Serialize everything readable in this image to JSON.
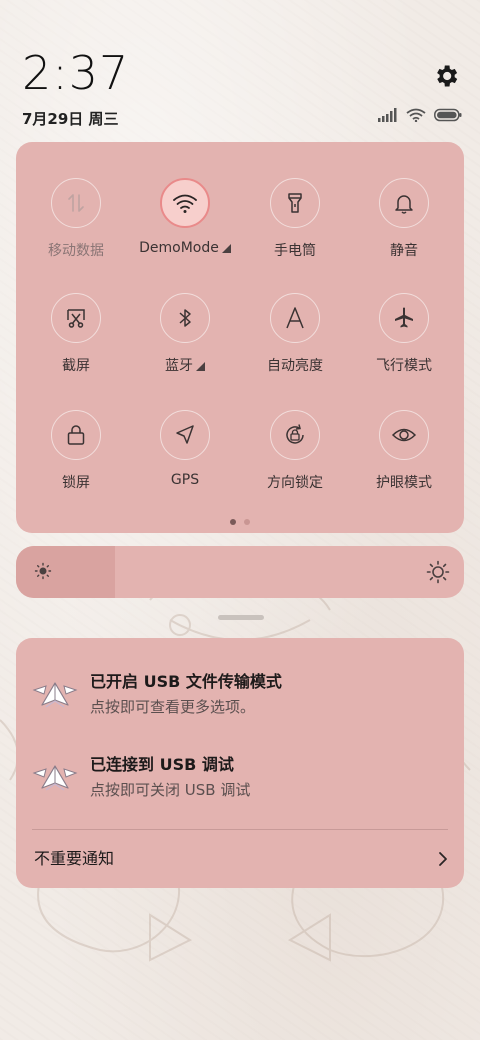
{
  "status": {
    "time": "2:37",
    "date": "7月29日 周三"
  },
  "quick_settings": {
    "tiles": [
      {
        "id": "mobile-data",
        "label": "移动数据",
        "icon": "mobile-data-icon",
        "state": "disabled"
      },
      {
        "id": "wifi",
        "label": "DemoMode",
        "icon": "wifi-icon",
        "state": "on",
        "has_menu": true
      },
      {
        "id": "flashlight",
        "label": "手电筒",
        "icon": "flashlight-icon",
        "state": "off"
      },
      {
        "id": "silent",
        "label": "静音",
        "icon": "bell-icon",
        "state": "off"
      },
      {
        "id": "screenshot",
        "label": "截屏",
        "icon": "screenshot-icon",
        "state": "off"
      },
      {
        "id": "bluetooth",
        "label": "蓝牙",
        "icon": "bluetooth-icon",
        "state": "off",
        "has_menu": true
      },
      {
        "id": "auto-brightness",
        "label": "自动亮度",
        "icon": "auto-brightness-icon",
        "state": "off"
      },
      {
        "id": "airplane",
        "label": "飞行模式",
        "icon": "airplane-icon",
        "state": "off"
      },
      {
        "id": "lock-screen",
        "label": "锁屏",
        "icon": "lock-icon",
        "state": "off"
      },
      {
        "id": "gps",
        "label": "GPS",
        "icon": "location-arrow-icon",
        "state": "off"
      },
      {
        "id": "rotation-lock",
        "label": "方向锁定",
        "icon": "rotation-lock-icon",
        "state": "off"
      },
      {
        "id": "eye-care",
        "label": "护眼模式",
        "icon": "eye-icon",
        "state": "off"
      }
    ],
    "page_count": 2,
    "current_page": 1
  },
  "brightness": {
    "level": 0.22
  },
  "notifications": [
    {
      "title": "已开启 USB 文件传输模式",
      "body": "点按即可查看更多选项。",
      "icon": "paper-plane-icon"
    },
    {
      "title": "已连接到 USB 调试",
      "body": "点按即可关闭 USB 调试",
      "icon": "paper-plane-icon"
    }
  ],
  "footer": {
    "label": "不重要通知"
  },
  "colors": {
    "panel": "#e3b3b0",
    "active_ring": "#e98a8a",
    "background": "#f1ebe6"
  }
}
